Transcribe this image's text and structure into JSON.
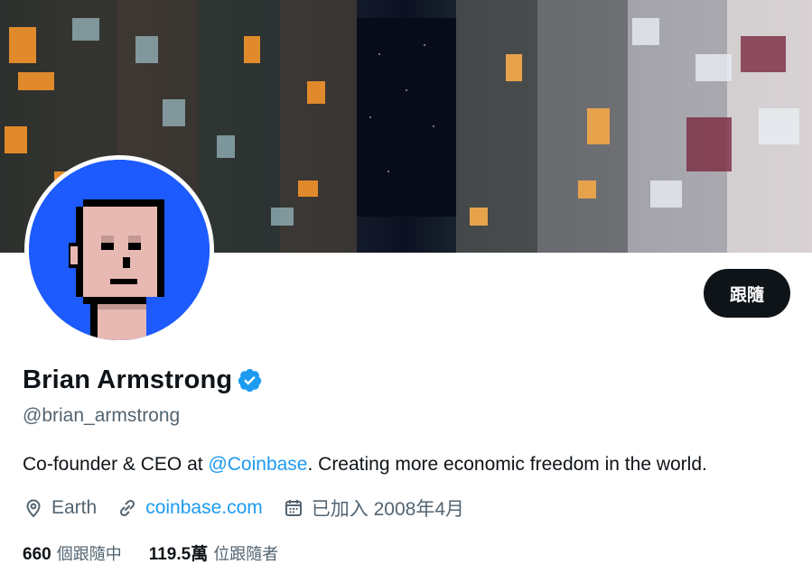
{
  "profile": {
    "name": "Brian Armstrong",
    "handle": "@brian_armstrong",
    "follow_label": "跟隨",
    "bio": {
      "prefix": "Co-founder & CEO at ",
      "mention": "@Coinbase",
      "suffix": ". Creating more economic freedom in the world."
    },
    "location": "Earth",
    "website": "coinbase.com",
    "joined": "已加入 2008年4月",
    "following_count": "660",
    "following_label": "個跟隨中",
    "followers_count": "119.5萬",
    "followers_label": "位跟隨者"
  },
  "icons": {
    "verified": "verified-badge-icon",
    "location": "location-pin-icon",
    "link": "link-icon",
    "calendar": "calendar-icon"
  },
  "colors": {
    "accent": "#1d9bf0",
    "text": "#0f1419",
    "secondary": "#536471",
    "button": "#0f1419",
    "avatar_bg": "#1d5bff"
  }
}
